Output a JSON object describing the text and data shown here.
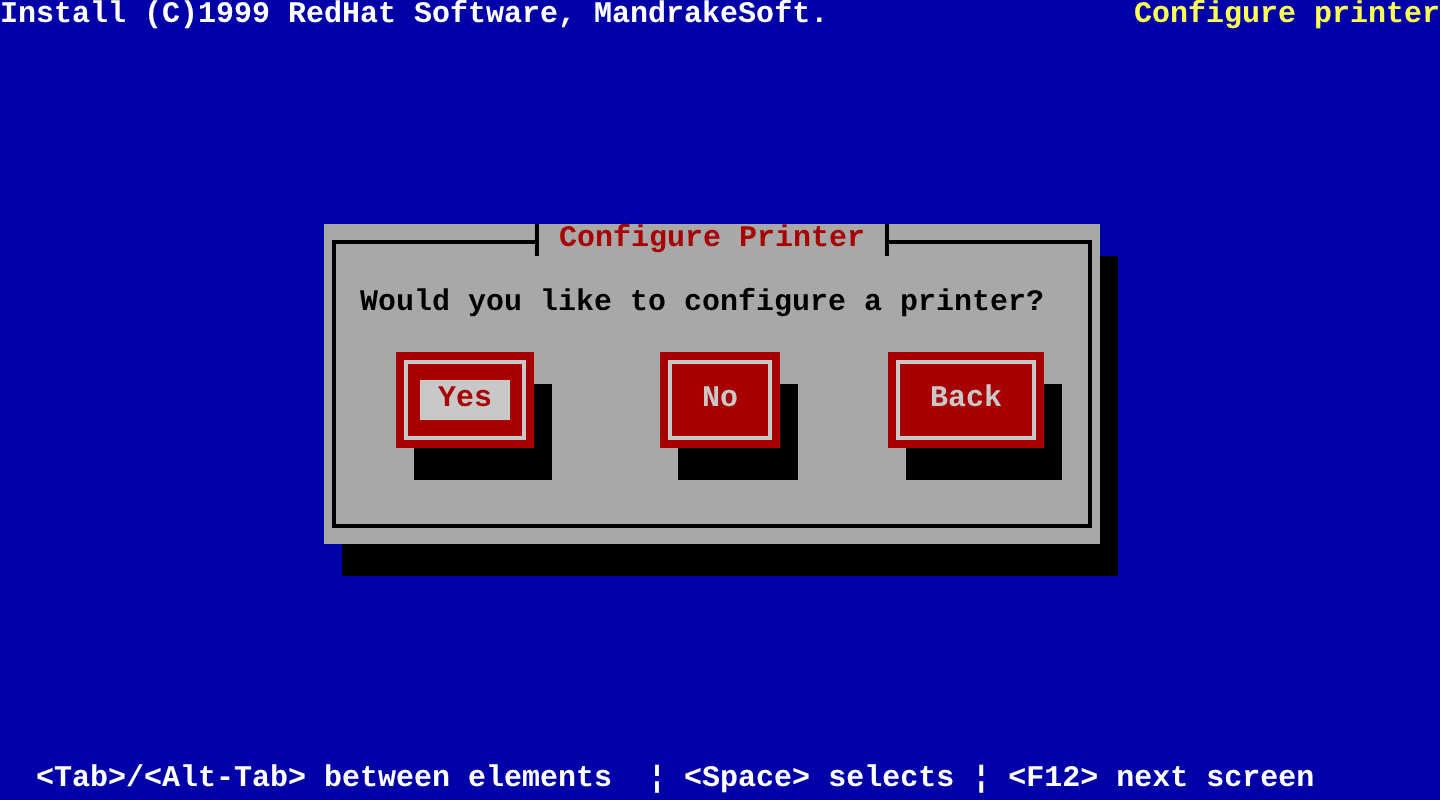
{
  "header": {
    "left": "Install (C)1999 RedHat Software, MandrakeSoft.",
    "right": "Configure printer"
  },
  "dialog": {
    "title": "Configure Printer",
    "message": "Would you like to configure a printer?",
    "buttons": [
      {
        "label": "Yes",
        "selected": true
      },
      {
        "label": "No",
        "selected": false
      },
      {
        "label": "Back",
        "selected": false
      }
    ]
  },
  "help_line": "<Tab>/<Alt-Tab> between elements  ¦ <Space> selects ¦ <F12> next screen"
}
